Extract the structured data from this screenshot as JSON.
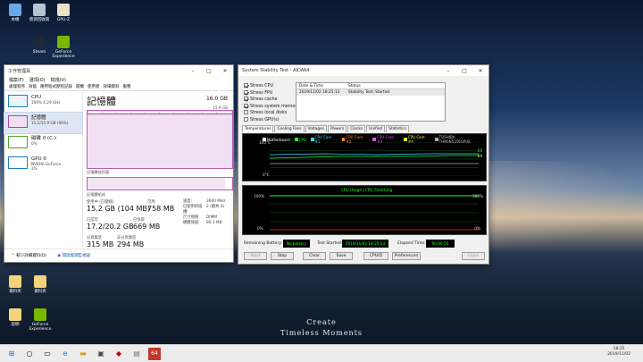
{
  "desktop": {
    "icons_top": [
      {
        "label": "本機"
      },
      {
        "label": "資源回收筒"
      },
      {
        "label": "GPU-Z"
      },
      {
        "label": "AIDA64"
      }
    ],
    "icons_mid": [
      {
        "label": "Steam"
      },
      {
        "label": "GeForce Experience"
      }
    ],
    "icons_bottom": [
      {
        "label": "資料夾"
      },
      {
        "label": "資料夾"
      },
      {
        "label": "說明"
      },
      {
        "label": "GeForce Experience"
      }
    ],
    "wallpaper_line1": "Create",
    "wallpaper_line2": "Timeless Moments"
  },
  "taskmgr": {
    "title": "工作管理員",
    "menu": [
      "檔案(F)",
      "選項(O)",
      "檢視(V)"
    ],
    "tabs": [
      "處理程序",
      "效能",
      "應用程式歷程記錄",
      "開機",
      "使用者",
      "詳細資料",
      "服務"
    ],
    "side": [
      {
        "name": "CPU",
        "sub": "100%  4.29 GHz"
      },
      {
        "name": "記憶體",
        "sub": "15.2/15.9 GB (96%)"
      },
      {
        "name": "磁碟 0 (C:)",
        "sub": "0%"
      },
      {
        "name": "GPU 0",
        "sub": "NVIDIA GeForce...",
        "sub2": "1%"
      }
    ],
    "main_title": "記憶體",
    "total": "16.0 GB",
    "graph_top": "15.9 GB",
    "graph_label": "記憶體使用量",
    "graph_percent": 96,
    "comp_label": "記憶體組成",
    "stats": {
      "in_use_k": "使用中 (已壓縮)",
      "in_use_v": "15.2 GB (104 MB)",
      "avail_k": "可用",
      "avail_v": "758 MB",
      "committed_k": "已認可",
      "committed_v": "17.2/20.2 GB",
      "cached_k": "已快取",
      "cached_v": "669 MB",
      "paged_k": "分頁集區",
      "paged_v": "315 MB",
      "nonpaged_k": "非分頁集區",
      "nonpaged_v": "294 MB"
    },
    "kv": [
      {
        "k": "速度:",
        "v": "3600 MHz"
      },
      {
        "k": "已使用的插槽:",
        "v": "2 (總共 4)"
      },
      {
        "k": "尺寸規格:",
        "v": "DIMM"
      },
      {
        "k": "硬體保留:",
        "v": "80.1 MB"
      }
    ],
    "foot_fewer": "較少詳細資料(D)",
    "foot_link": "開啟資源監視器"
  },
  "aida": {
    "title": "System Stability Test - AIDA64",
    "checks": [
      {
        "label": "Stress CPU",
        "on": true
      },
      {
        "label": "Stress FPU",
        "on": true
      },
      {
        "label": "Stress cache",
        "on": true
      },
      {
        "label": "Stress system memory",
        "on": true
      },
      {
        "label": "Stress local disks",
        "on": false
      },
      {
        "label": "Stress GPU(s)",
        "on": false
      }
    ],
    "log_head_date": "Date & Time",
    "log_head_status": "Status",
    "log_date": "2019/11/02 18:25:13",
    "log_status": "Stability Test: Started",
    "tabs": [
      "Temperatures",
      "Cooling Fans",
      "Voltages",
      "Powers",
      "Clocks",
      "Unified",
      "Statistics"
    ],
    "legend": [
      {
        "label": "Motherboard",
        "color": "#ffffff"
      },
      {
        "label": "CPU",
        "color": "#22ff22"
      },
      {
        "label": "CPU Core #1",
        "color": "#33ddff"
      },
      {
        "label": "CPU Core #2",
        "color": "#ff8833"
      },
      {
        "label": "CPU Core #3",
        "color": "#dd55ff"
      },
      {
        "label": "CPU Core #4",
        "color": "#ffff33"
      },
      {
        "label": "TOSHIBA THNSN5256GPUK",
        "color": "#aaaaaa"
      }
    ],
    "temp_top": "100°C",
    "temp_bottom": "0°C",
    "temp_right_1": "58",
    "temp_right_2": "69",
    "usage_title": "CPU Usage  |  CPU Throttling",
    "usage_top": "100%",
    "usage_bottom": "0%",
    "usage_right_top": "100%",
    "usage_right_bottom": "0%",
    "remaining_label": "Remaining Battery:",
    "remaining_value": "No battery",
    "started_label": "Test Started:",
    "started_value": "2019/11/02 18:25:13",
    "elapsed_label": "Elapsed Time:",
    "elapsed_value": "00:00:55",
    "buttons": [
      "Start",
      "Stop",
      "Clear",
      "Save",
      "CPUID",
      "Preferences",
      "Close"
    ]
  },
  "taskbar": {
    "time": "18:25",
    "date": "2019/11/02"
  }
}
